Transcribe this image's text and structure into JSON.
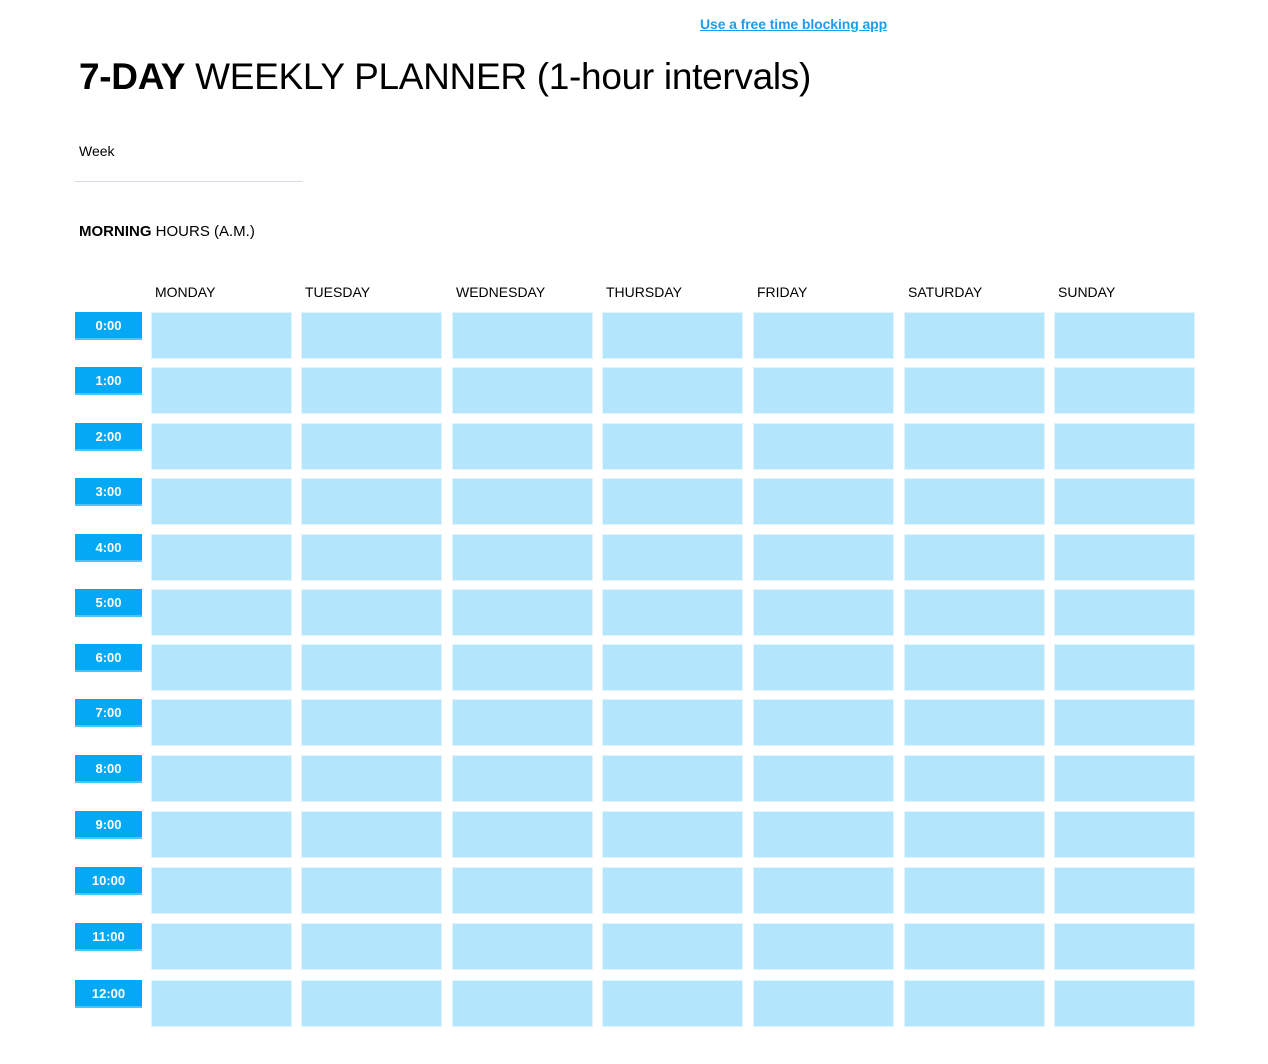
{
  "top_link": {
    "label": "Use a free time blocking app"
  },
  "title": {
    "bold": "7-DAY",
    "rest": " WEEKLY PLANNER (1-hour intervals)"
  },
  "week": {
    "label": "Week",
    "value": ""
  },
  "section": {
    "bold": "MORNING",
    "rest": " HOURS (A.M.)"
  },
  "colors": {
    "time_label_bg": "#03a9f4",
    "cell_bg": "#b3e5fc",
    "link": "#1a9ef0"
  },
  "days": [
    "MONDAY",
    "TUESDAY",
    "WEDNESDAY",
    "THURSDAY",
    "FRIDAY",
    "SATURDAY",
    "SUNDAY"
  ],
  "times": [
    "0:00",
    "1:00",
    "2:00",
    "3:00",
    "4:00",
    "5:00",
    "6:00",
    "7:00",
    "8:00",
    "9:00",
    "10:00",
    "11:00",
    "12:00"
  ]
}
